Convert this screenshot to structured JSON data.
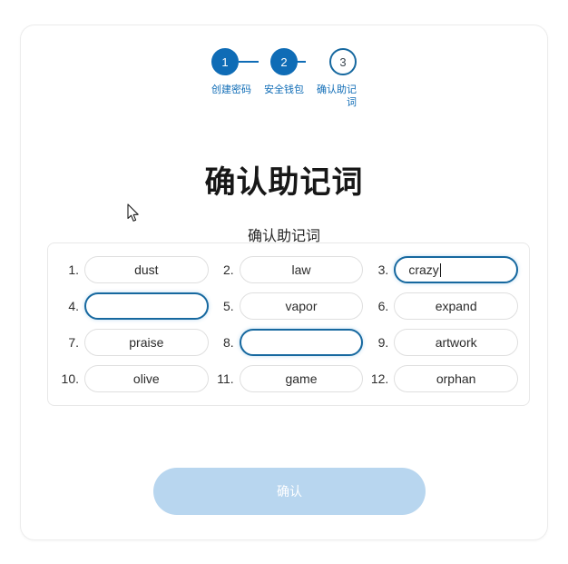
{
  "theme": {
    "accent": "#0f6cb6",
    "accent_outline": "#16689f",
    "button_disabled_bg": "#b8d6ef",
    "card_border": "#ececec",
    "slot_border": "#dfdfdf",
    "text_primary": "#171717"
  },
  "stepper": {
    "steps": [
      {
        "number": "1",
        "label": "创建密码",
        "state": "done"
      },
      {
        "number": "2",
        "label": "安全钱包",
        "state": "done"
      },
      {
        "number": "3",
        "label": "确认助记词",
        "state": "todo"
      }
    ]
  },
  "heading": {
    "title": "确认助记词",
    "subtitle": "确认助记词"
  },
  "mnemonic": {
    "slots": [
      {
        "index": "1.",
        "value": "dust",
        "state": "filled"
      },
      {
        "index": "2.",
        "value": "law",
        "state": "filled"
      },
      {
        "index": "3.",
        "value": "crazy",
        "state": "focused"
      },
      {
        "index": "4.",
        "value": "",
        "state": "empty"
      },
      {
        "index": "5.",
        "value": "vapor",
        "state": "filled"
      },
      {
        "index": "6.",
        "value": "expand",
        "state": "filled"
      },
      {
        "index": "7.",
        "value": "praise",
        "state": "filled"
      },
      {
        "index": "8.",
        "value": "",
        "state": "empty"
      },
      {
        "index": "9.",
        "value": "artwork",
        "state": "filled"
      },
      {
        "index": "10.",
        "value": "olive",
        "state": "filled"
      },
      {
        "index": "11.",
        "value": "game",
        "state": "filled"
      },
      {
        "index": "12.",
        "value": "orphan",
        "state": "filled"
      }
    ]
  },
  "actions": {
    "confirm_label": "确认",
    "confirm_enabled": false
  }
}
